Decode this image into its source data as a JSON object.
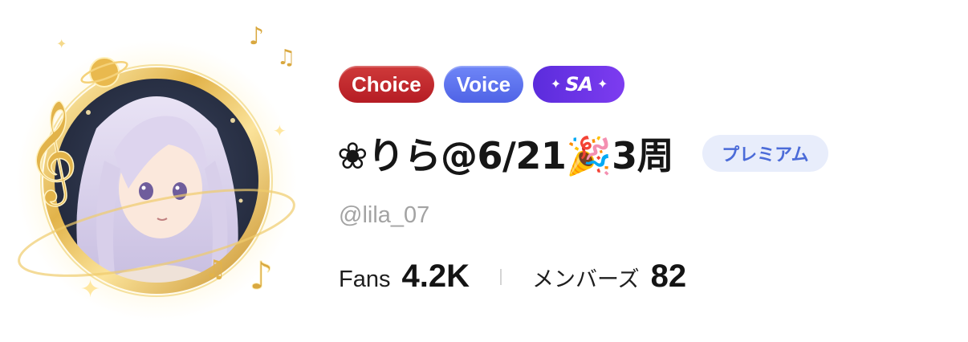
{
  "profile": {
    "badges": [
      {
        "label": "Choice"
      },
      {
        "label": "Voice"
      },
      {
        "label": "SA",
        "icon": "sparkle-icon"
      }
    ],
    "display_name": "❀りら@6/21🎉3周",
    "premium_label": "プレミアム",
    "handle": "@lila_07",
    "stats": {
      "fans_label": "Fans",
      "fans_value": "4.2K",
      "members_label": "メンバーズ",
      "members_value": "82"
    }
  },
  "colors": {
    "choice": "#c02a2f",
    "voice": "#5a6fee",
    "sa": "#6a33e6",
    "premium_bg": "#e8edfb",
    "premium_text": "#4b6bd8",
    "frame_gold": "#e3b94d"
  }
}
